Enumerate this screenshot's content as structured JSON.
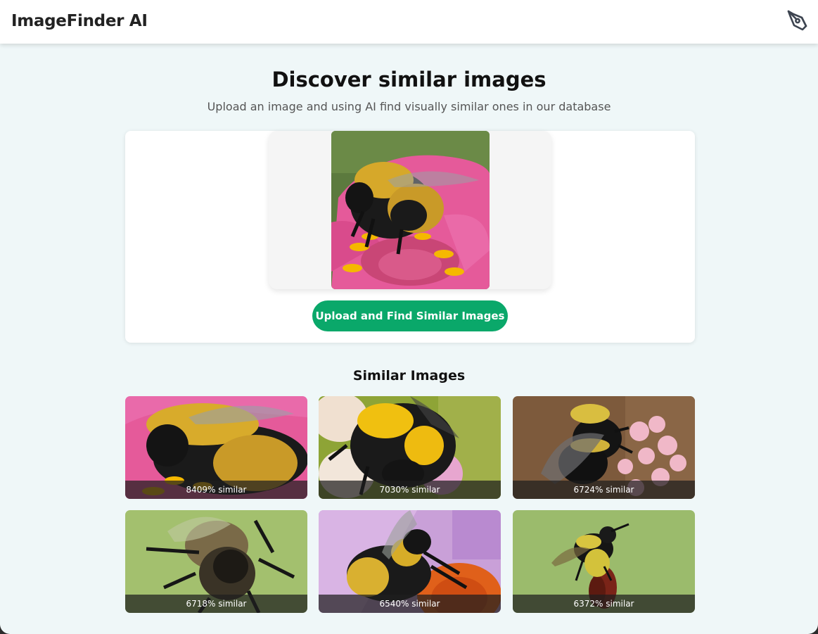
{
  "header": {
    "title": "ImageFinder AI",
    "icon": "pen-tool-icon"
  },
  "hero": {
    "title": "Discover similar images",
    "subtitle": "Upload an image and using AI find visually similar ones in our database"
  },
  "upload": {
    "button_label": "Upload and Find Similar Images"
  },
  "results": {
    "title": "Similar Images",
    "items": [
      {
        "caption": "8409% similar"
      },
      {
        "caption": "7030% similar"
      },
      {
        "caption": "6724% similar"
      },
      {
        "caption": "6718% similar"
      },
      {
        "caption": "6540% similar"
      },
      {
        "caption": "6372% similar"
      }
    ]
  },
  "colors": {
    "accent": "#0aa86a",
    "page_bg": "#eff7f8",
    "caption_bg": "#1e1e1e"
  }
}
